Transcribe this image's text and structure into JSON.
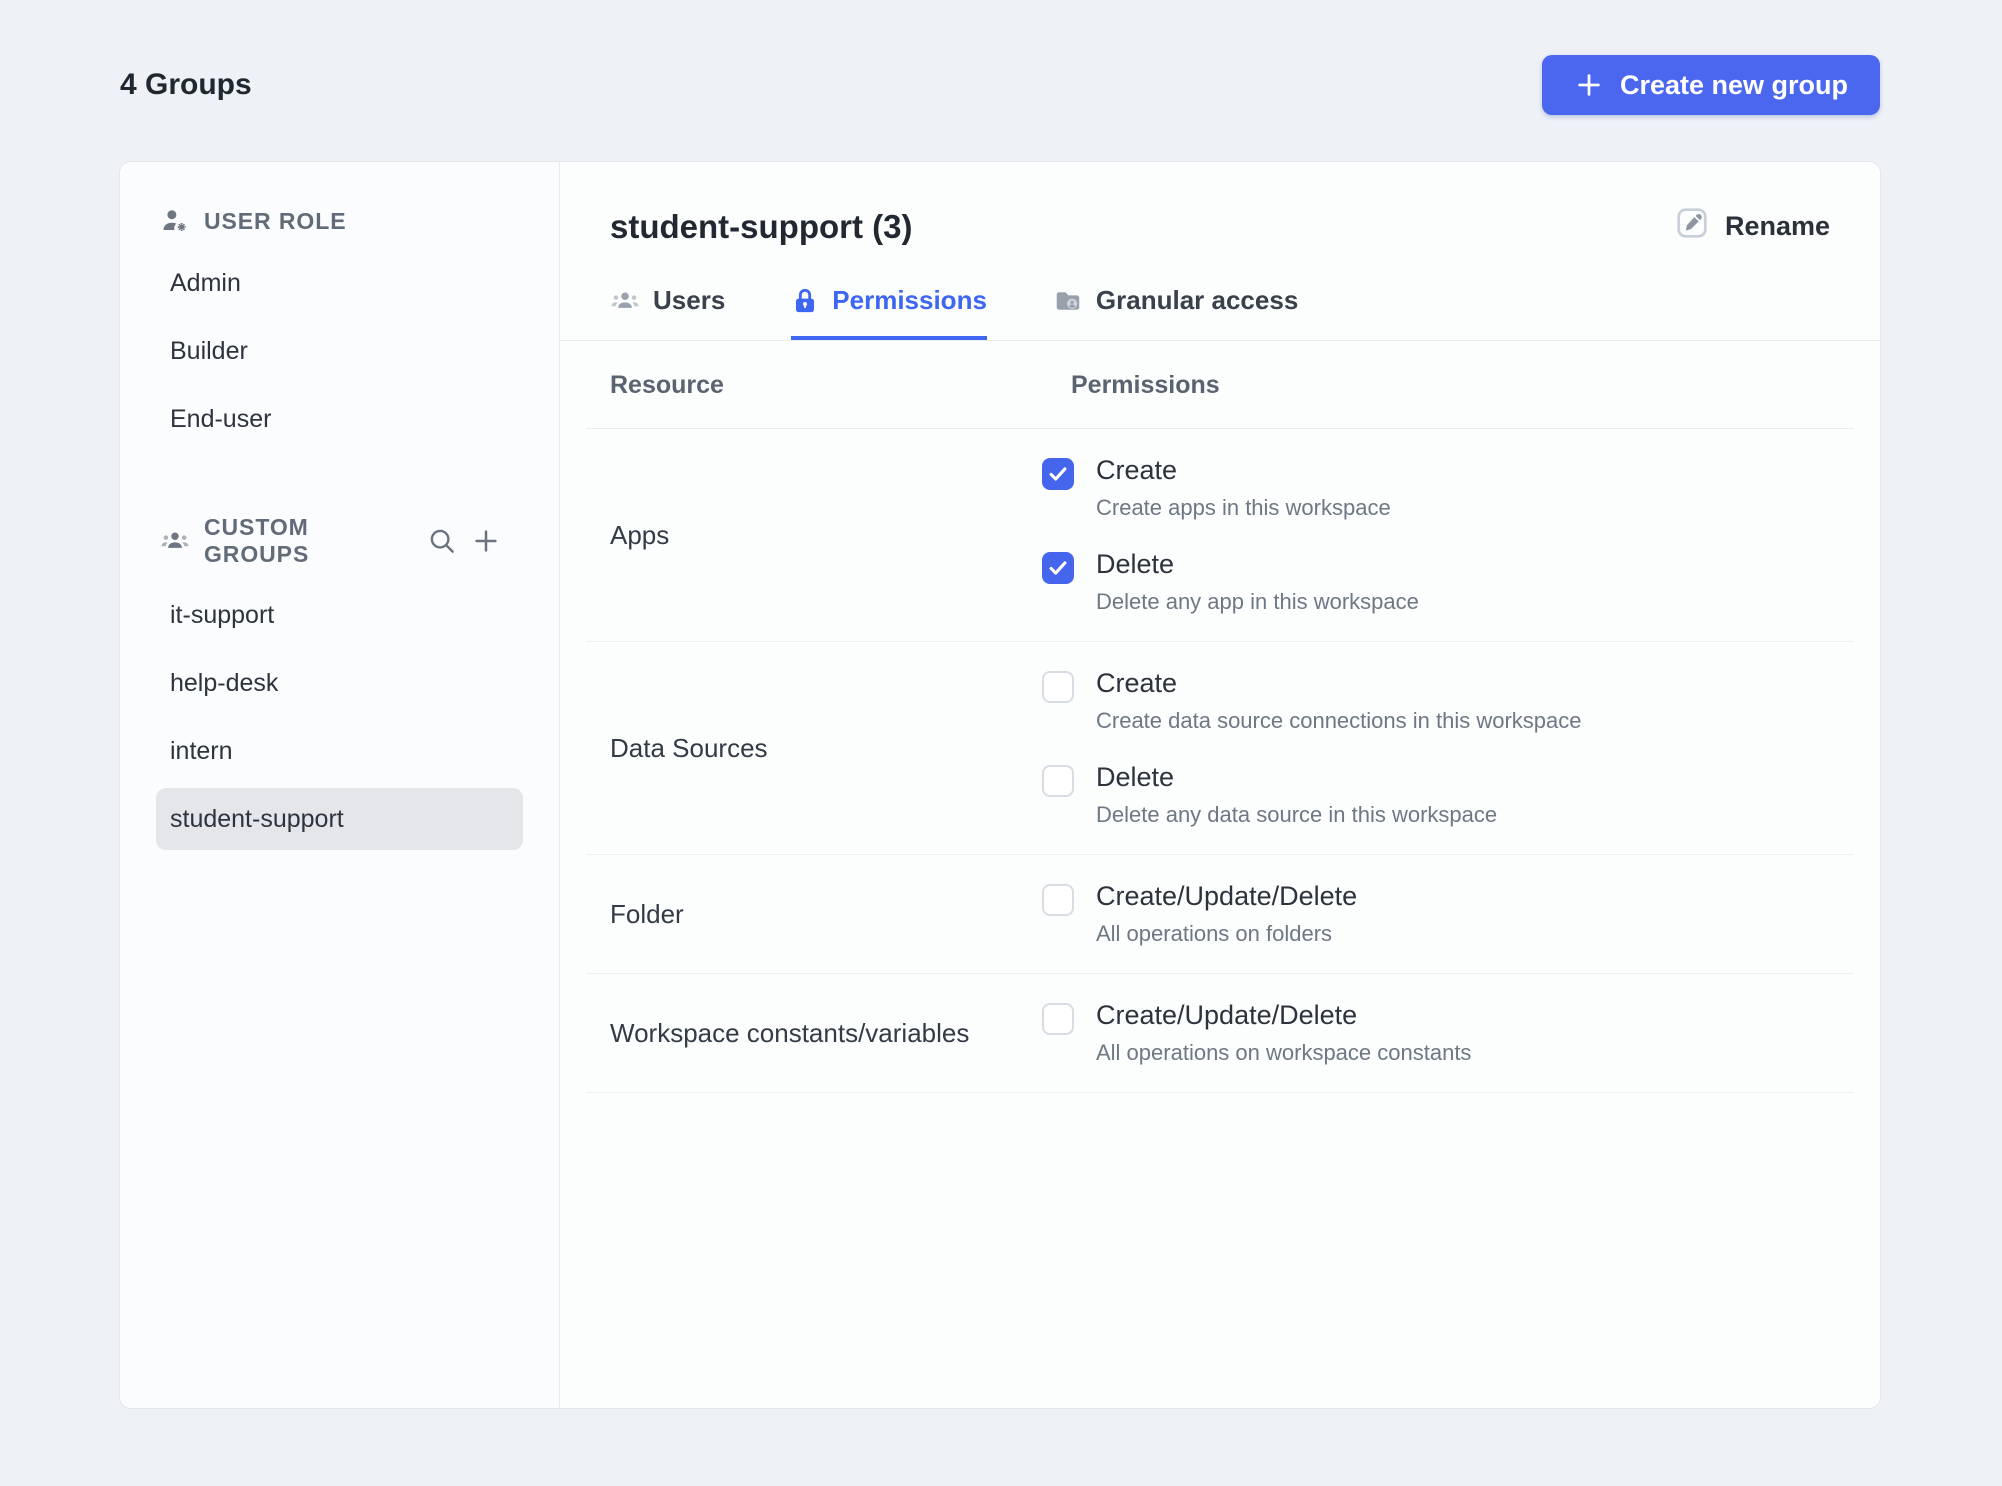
{
  "header": {
    "groups_count_label": "4 Groups",
    "create_button_label": "Create new group"
  },
  "sidebar": {
    "user_role": {
      "title": "USER ROLE",
      "icon": "user-gear-icon",
      "items": [
        {
          "label": "Admin",
          "selected": false
        },
        {
          "label": "Builder",
          "selected": false
        },
        {
          "label": "End-user",
          "selected": false
        }
      ]
    },
    "custom_groups": {
      "title": "CUSTOM GROUPS",
      "icon": "people-group-icon",
      "actions": [
        "search-icon",
        "plus-icon"
      ],
      "items": [
        {
          "label": "it-support",
          "selected": false
        },
        {
          "label": "help-desk",
          "selected": false
        },
        {
          "label": "intern",
          "selected": false
        },
        {
          "label": "student-support",
          "selected": true
        }
      ]
    }
  },
  "main": {
    "title": "student-support (3)",
    "rename_label": "Rename",
    "tabs": [
      {
        "label": "Users",
        "icon": "users-icon",
        "active": false
      },
      {
        "label": "Permissions",
        "icon": "lock-icon",
        "active": true
      },
      {
        "label": "Granular access",
        "icon": "folder-user-icon",
        "active": false
      }
    ],
    "table": {
      "columns": [
        "Resource",
        "Permissions"
      ],
      "rows": [
        {
          "resource": "Apps",
          "permissions": [
            {
              "label": "Create",
              "description": "Create apps in this workspace",
              "checked": true
            },
            {
              "label": "Delete",
              "description": "Delete any app in this workspace",
              "checked": true
            }
          ]
        },
        {
          "resource": "Data Sources",
          "permissions": [
            {
              "label": "Create",
              "description": "Create data source connections in this workspace",
              "checked": false
            },
            {
              "label": "Delete",
              "description": "Delete any data source in this workspace",
              "checked": false
            }
          ]
        },
        {
          "resource": "Folder",
          "permissions": [
            {
              "label": "Create/Update/Delete",
              "description": "All operations on folders",
              "checked": false
            }
          ]
        },
        {
          "resource": "Workspace constants/variables",
          "permissions": [
            {
              "label": "Create/Update/Delete",
              "description": "All operations on workspace constants",
              "checked": false
            }
          ]
        }
      ]
    }
  },
  "colors": {
    "accent": "#4565EC",
    "accent_button": "#4B67EF",
    "tab_active": "#3D66F2",
    "page_background": "#EEF2F7",
    "card_background": "#FCFDFD",
    "selected_item_background": "#E4E6EA",
    "border": "#E8EBEF",
    "text_primary": "#232A33",
    "text_secondary": "#5A6370",
    "text_muted": "#6E7884"
  }
}
